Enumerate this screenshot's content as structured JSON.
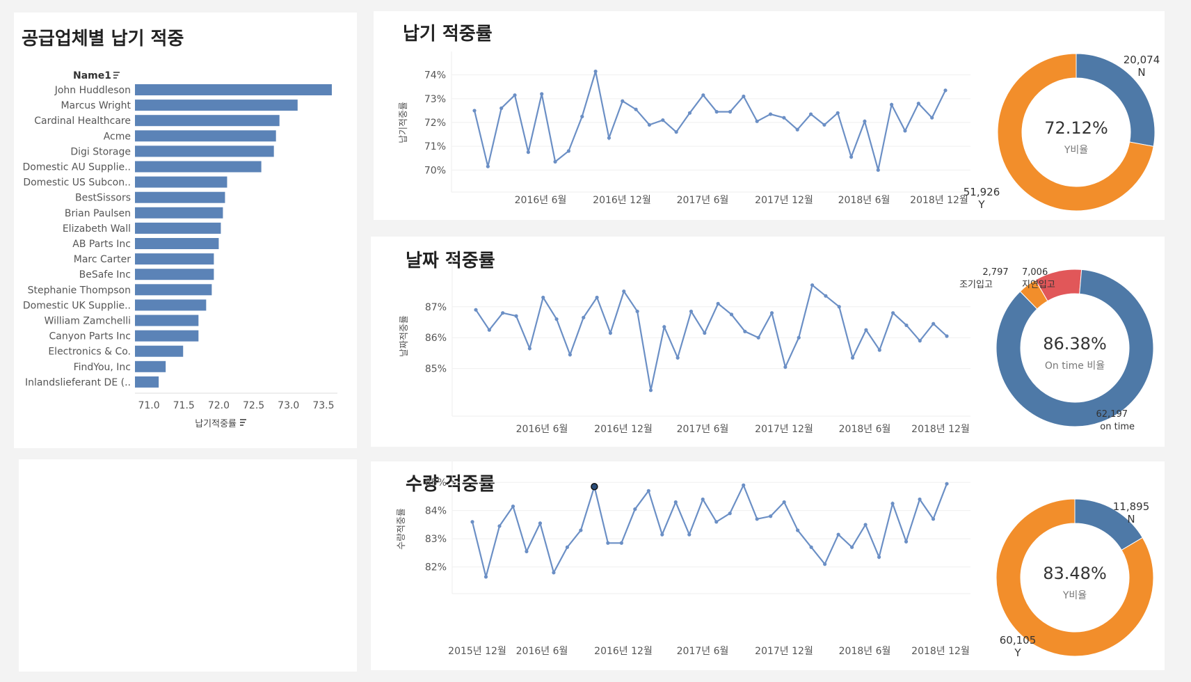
{
  "supplier_chart": {
    "title": "공급업체별 납기 적중",
    "row_header": "Name1",
    "xlabel": "납기적중률",
    "x_ticks": [
      "71.0",
      "71.5",
      "72.0",
      "72.5",
      "73.0",
      "73.5"
    ]
  },
  "delivery_panel": {
    "title": "납기 적중률",
    "ylabel": "납기적중률",
    "donut": {
      "center_value": "72.12%",
      "center_label": "Y비율",
      "labels": [
        {
          "value": "20,074",
          "name": "N"
        },
        {
          "value": "51,926",
          "name": "Y"
        }
      ]
    }
  },
  "date_panel": {
    "title": "날짜 적중률",
    "ylabel": "날짜적중률",
    "donut": {
      "center_value": "86.38%",
      "center_label": "On time 비율",
      "labels": [
        {
          "value": "2,797",
          "name": "조기입고"
        },
        {
          "value": "7,006",
          "name": "지연입고"
        },
        {
          "value": "62,197",
          "name": "on time"
        }
      ]
    }
  },
  "qty_panel": {
    "title": "수량 적중률",
    "ylabel": "수량적중률",
    "donut": {
      "center_value": "83.48%",
      "center_label": "Y비율",
      "labels": [
        {
          "value": "11,895",
          "name": "N"
        },
        {
          "value": "60,105",
          "name": "Y"
        }
      ]
    }
  },
  "colors": {
    "bar": "#5b83b7",
    "line": "#6b8fc5",
    "donut_blue": "#4e79a7",
    "donut_orange": "#f28e2b",
    "donut_red": "#e15759"
  },
  "chart_data": [
    {
      "type": "bar",
      "title": "공급업체별 납기 적중",
      "xlabel": "납기적중률",
      "categories": [
        "John Huddleson",
        "Marcus Wright",
        "Cardinal Healthcare",
        "Acme",
        "Digi Storage",
        "Domestic AU Supplie..",
        "Domestic US Subcon..",
        "BestSissors",
        "Brian Paulsen",
        "Elizabeth Wall",
        "AB Parts Inc",
        "Marc Carter",
        "BeSafe Inc",
        "Stephanie Thompson",
        "Domestic UK Supplie..",
        "William Zamchelli",
        "Canyon Parts Inc",
        "Electronics & Co.",
        "FindYou, Inc",
        "Inlandslieferant DE (.."
      ],
      "values": [
        73.62,
        73.13,
        72.87,
        72.82,
        72.79,
        72.61,
        72.12,
        72.09,
        72.06,
        72.03,
        72.0,
        71.93,
        71.93,
        71.9,
        71.82,
        71.71,
        71.71,
        71.49,
        71.24,
        71.14
      ],
      "xlim": [
        70.8,
        73.7
      ]
    },
    {
      "type": "line",
      "title": "납기 적중률",
      "ylabel": "납기적중률",
      "x_ticks": [
        "2016년 6월",
        "2016년 12월",
        "2017년 6월",
        "2017년 12월",
        "2018년 6월",
        "2018년 12월"
      ],
      "x": [
        "2015-12",
        "2016-01",
        "2016-02",
        "2016-03",
        "2016-04",
        "2016-05",
        "2016-06",
        "2016-07",
        "2016-08",
        "2016-09",
        "2016-10",
        "2016-11",
        "2016-12",
        "2017-01",
        "2017-02",
        "2017-03",
        "2017-04",
        "2017-05",
        "2017-06",
        "2017-07",
        "2017-08",
        "2017-09",
        "2017-10",
        "2017-11",
        "2017-12",
        "2018-01",
        "2018-02",
        "2018-03",
        "2018-04",
        "2018-05",
        "2018-06",
        "2018-07",
        "2018-08",
        "2018-09",
        "2018-10",
        "2018-11",
        "2018-12"
      ],
      "values": [
        72.5,
        70.15,
        72.6,
        73.15,
        70.75,
        73.2,
        70.35,
        70.8,
        72.25,
        74.15,
        71.35,
        72.9,
        72.55,
        71.9,
        72.1,
        71.6,
        72.4,
        73.15,
        72.45,
        72.45,
        73.1,
        72.05,
        72.35,
        72.2,
        71.7,
        72.35,
        71.9,
        72.4,
        70.55,
        72.05,
        70.0,
        72.75,
        71.65,
        72.8,
        72.2,
        73.35
      ],
      "y_ticks": [
        "70%",
        "71%",
        "72%",
        "73%",
        "74%"
      ],
      "ylim": [
        69.6,
        74.4
      ]
    },
    {
      "type": "pie",
      "title": "Y비율",
      "categories": [
        "N",
        "Y"
      ],
      "values": [
        20074,
        51926
      ],
      "center_text": "72.12%"
    },
    {
      "type": "line",
      "title": "날짜 적중률",
      "ylabel": "날짜적중률",
      "x_ticks": [
        "2016년 6월",
        "2016년 12월",
        "2017년 6월",
        "2017년 12월",
        "2018년 6월",
        "2018년 12월"
      ],
      "values": [
        86.9,
        86.25,
        86.8,
        86.7,
        85.65,
        87.3,
        86.6,
        85.45,
        86.65,
        87.3,
        86.15,
        87.5,
        86.85,
        84.3,
        86.35,
        85.35,
        86.85,
        86.15,
        87.1,
        86.75,
        86.2,
        86.0,
        86.8,
        85.05,
        86.0,
        87.7,
        87.35,
        87.0,
        85.35,
        86.25,
        85.6,
        86.8,
        86.4,
        85.9,
        86.45,
        86.05
      ],
      "y_ticks": [
        "85%",
        "86%",
        "87%"
      ],
      "ylim": [
        83.8,
        88.3
      ]
    },
    {
      "type": "pie",
      "title": "On time 비율",
      "categories": [
        "조기입고",
        "지연입고",
        "on time"
      ],
      "values": [
        2797,
        7006,
        62197
      ],
      "center_text": "86.38%"
    },
    {
      "type": "line",
      "title": "수량 적중률",
      "ylabel": "수량적중률",
      "x_ticks": [
        "2015년 12월",
        "2016년 6월",
        "2016년 12월",
        "2017년 6월",
        "2017년 12월",
        "2018년 6월",
        "2018년 12월"
      ],
      "values": [
        83.6,
        81.65,
        83.45,
        84.15,
        82.55,
        83.55,
        81.8,
        82.7,
        83.3,
        84.85,
        82.85,
        82.85,
        84.05,
        84.7,
        83.15,
        84.3,
        83.15,
        84.4,
        83.6,
        83.9,
        84.9,
        83.7,
        83.8,
        84.3,
        83.3,
        82.7,
        82.1,
        83.15,
        82.7,
        83.5,
        82.35,
        84.25,
        82.9,
        84.4,
        83.7,
        84.95
      ],
      "y_ticks": [
        "82%",
        "83%",
        "84%",
        "85%"
      ],
      "ylim": [
        81.4,
        85.3
      ]
    },
    {
      "type": "pie",
      "title": "Y비율",
      "categories": [
        "N",
        "Y"
      ],
      "values": [
        11895,
        60105
      ],
      "center_text": "83.48%"
    }
  ]
}
